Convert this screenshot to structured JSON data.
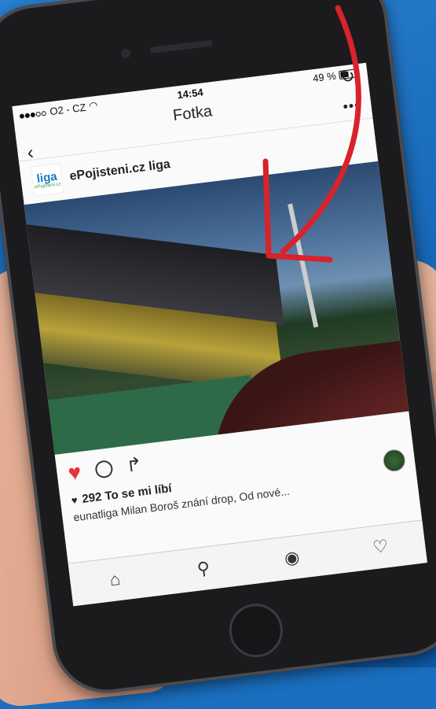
{
  "status_bar": {
    "carrier": "O2 - CZ",
    "time": "14:54",
    "battery": "49 %",
    "battery_level": 0.49
  },
  "nav": {
    "title": "Fotka"
  },
  "post": {
    "username": "ePojisteni.cz liga",
    "avatar_text": "liga",
    "avatar_subtext": "ePojisteni.cz",
    "likes": "292 To se mi líbí",
    "caption": "eunatliga Milan Boroš znání drop, Od nové..."
  },
  "icons": {
    "back": "chevron-left-icon",
    "refresh": "refresh-icon",
    "more": "ellipsis-icon",
    "like": "heart-icon",
    "comment": "comment-icon",
    "share": "share-icon",
    "home": "home-icon",
    "search": "search-icon",
    "camera": "camera-icon",
    "activity": "heart-outline-icon"
  },
  "colors": {
    "background": "#1565b5",
    "accent": "#e8323c",
    "phone": "#1b1b1d"
  }
}
